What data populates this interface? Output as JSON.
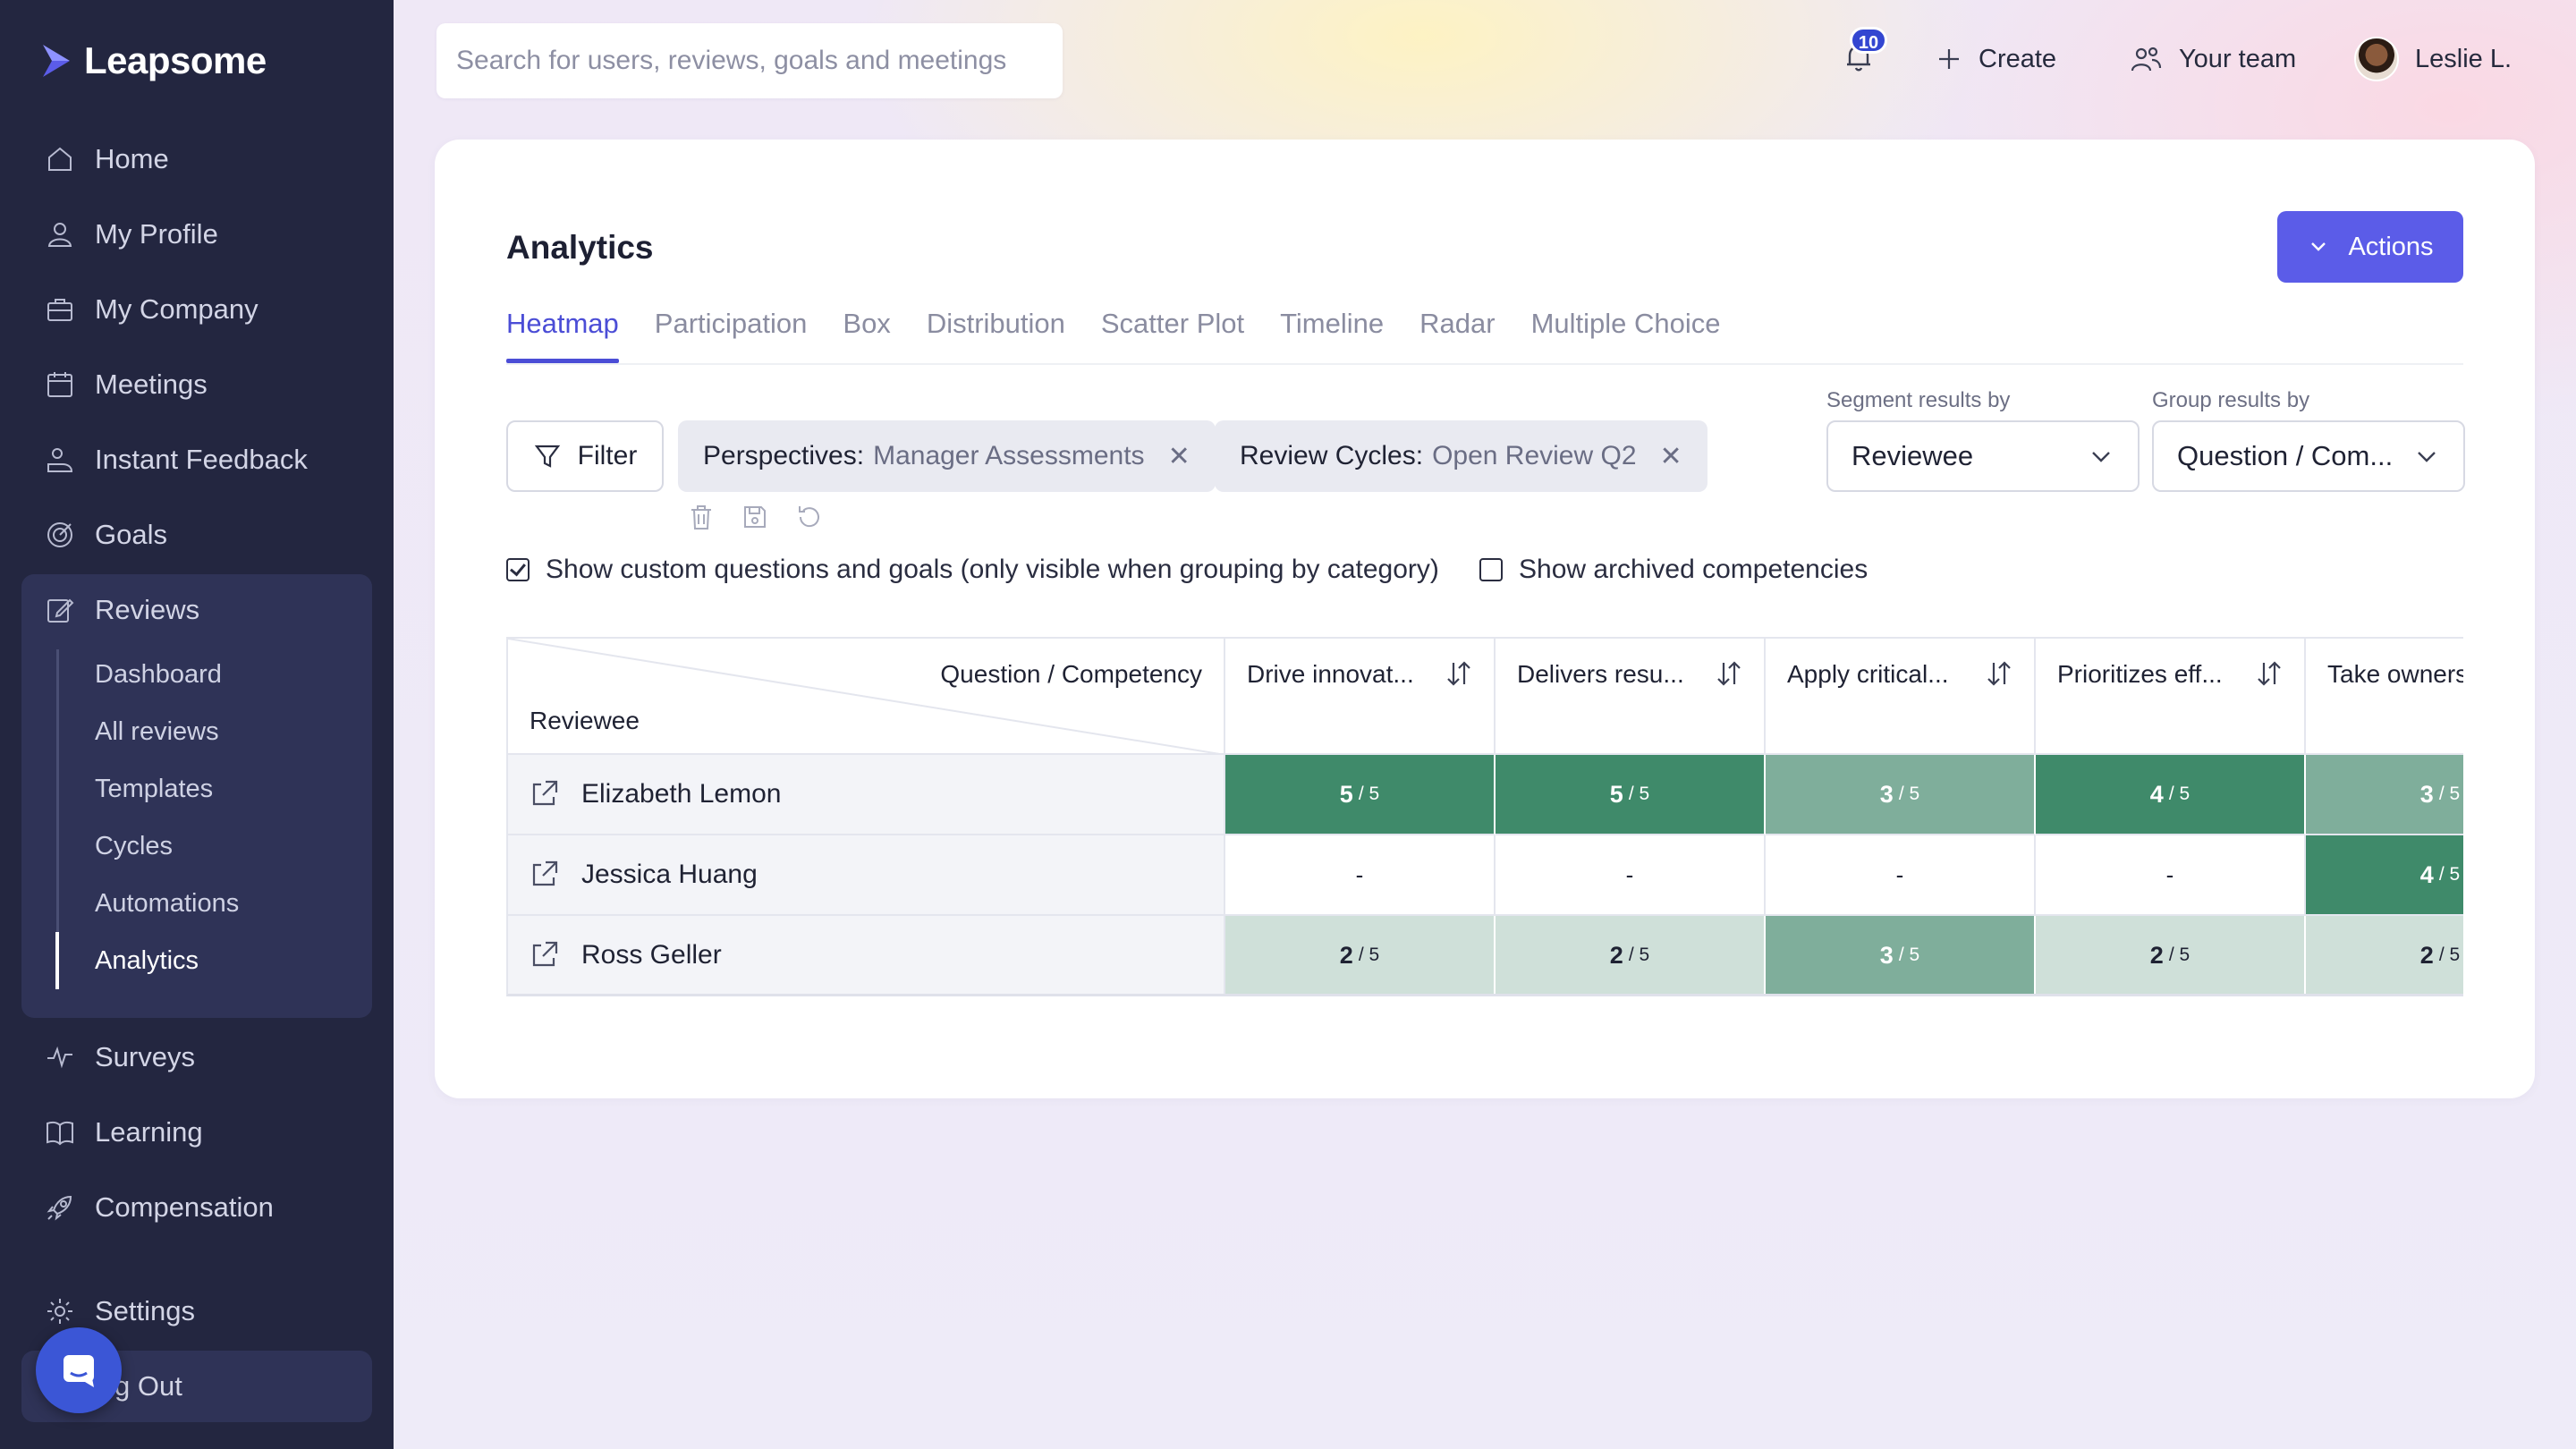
{
  "app": {
    "name": "Leapsome"
  },
  "sidebar": {
    "items": [
      {
        "label": "Home",
        "icon": "home-icon"
      },
      {
        "label": "My Profile",
        "icon": "user-icon"
      },
      {
        "label": "My Company",
        "icon": "briefcase-icon"
      },
      {
        "label": "Meetings",
        "icon": "calendar-icon"
      },
      {
        "label": "Instant Feedback",
        "icon": "feedback-icon"
      },
      {
        "label": "Goals",
        "icon": "target-icon"
      },
      {
        "label": "Reviews",
        "icon": "edit-icon"
      }
    ],
    "reviews_sub": [
      "Dashboard",
      "All reviews",
      "Templates",
      "Cycles",
      "Automations",
      "Analytics"
    ],
    "active_sub": "Analytics",
    "items_bottom": [
      {
        "label": "Surveys",
        "icon": "pulse-icon"
      },
      {
        "label": "Learning",
        "icon": "book-icon"
      },
      {
        "label": "Compensation",
        "icon": "rocket-icon"
      }
    ],
    "settings": "Settings",
    "logout": "Log Out",
    "logout_visible": "g Out"
  },
  "topbar": {
    "search_placeholder": "Search for users, reviews, goals and meetings",
    "notifications_count": "10",
    "create_label": "Create",
    "team_label": "Your team",
    "user_name": "Leslie L."
  },
  "page": {
    "title": "Analytics",
    "actions_label": "Actions",
    "tabs": [
      "Heatmap",
      "Participation",
      "Box",
      "Distribution",
      "Scatter Plot",
      "Timeline",
      "Radar",
      "Multiple Choice"
    ],
    "active_tab": "Heatmap"
  },
  "filters": {
    "filter_label": "Filter",
    "chips": [
      {
        "key": "Perspectives:",
        "value": "Manager Assessments"
      },
      {
        "key": "Review Cycles:",
        "value": "Open Review Q2"
      }
    ],
    "segment_label": "Segment results by",
    "segment_value": "Reviewee",
    "group_label": "Group results by",
    "group_value": "Question / Com..."
  },
  "options": {
    "custom_questions": {
      "label": "Show custom questions and goals (only visible when grouping by category)",
      "checked": true
    },
    "archived": {
      "label": "Show archived competencies",
      "checked": false
    }
  },
  "heatmap": {
    "corner_top": "Question / Competency",
    "corner_left": "Reviewee",
    "columns": [
      "Drive innovat...",
      "Delivers resu...",
      "Apply critical...",
      "Prioritizes eff...",
      "Take owners"
    ],
    "max": "5",
    "rows": [
      {
        "name": "Elizabeth Lemon",
        "scores": [
          "5",
          "5",
          "3",
          "4",
          "3"
        ]
      },
      {
        "name": "Jessica Huang",
        "scores": [
          "-",
          "-",
          "-",
          "-",
          "4"
        ]
      },
      {
        "name": "Ross Geller",
        "scores": [
          "2",
          "2",
          "3",
          "2",
          "2"
        ]
      }
    ],
    "colors": {
      "5": "#3f8a6a",
      "4": "#3f8a6a",
      "3": "#7fae9b",
      "2": "#cfe0d9",
      "-": "#ffffff"
    }
  },
  "colors": {
    "accent": "#5b5ce8",
    "sidebar": "#232640",
    "tab_active": "#4b4dd6"
  }
}
